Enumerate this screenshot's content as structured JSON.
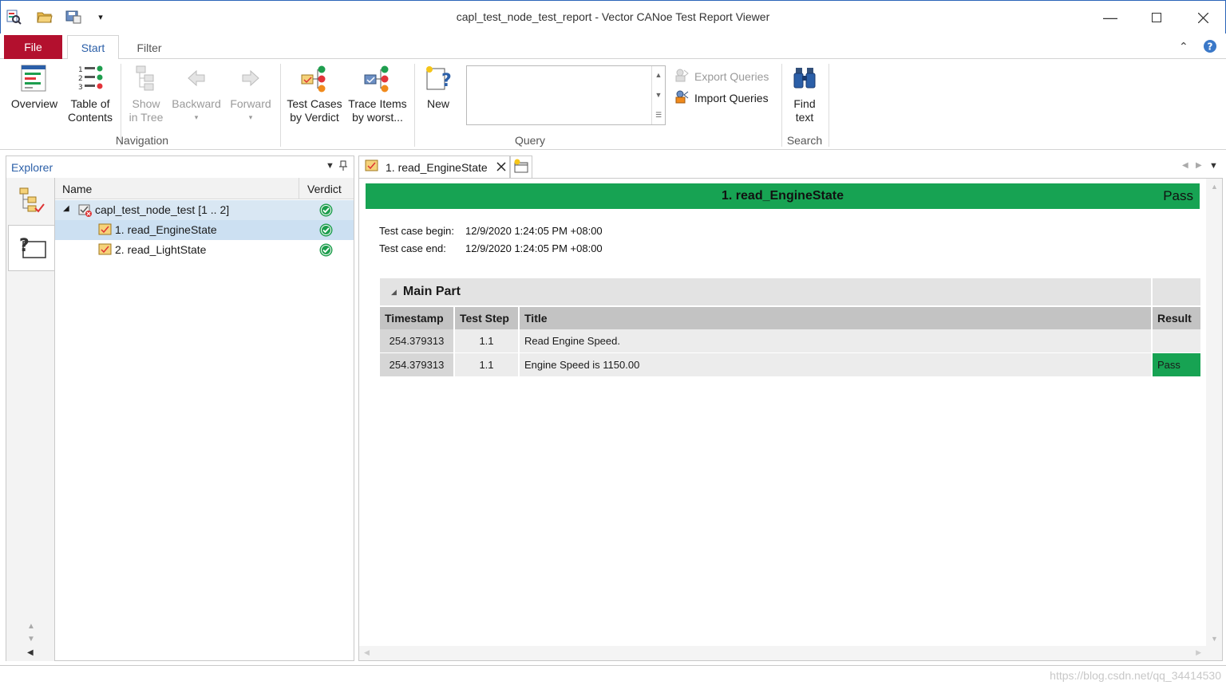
{
  "window": {
    "title": "capl_test_node_test_report - Vector CANoe Test Report Viewer"
  },
  "ribbon_tabs": {
    "file": "File",
    "start": "Start",
    "filter": "Filter"
  },
  "ribbon": {
    "overview": "Overview",
    "toc_line1": "Table of",
    "toc_line2": "Contents",
    "show_line1": "Show",
    "show_line2": "in Tree",
    "backward": "Backward",
    "forward": "Forward",
    "navigation_group": "Navigation",
    "tc_line1": "Test Cases",
    "tc_line2": "by Verdict",
    "ti_line1": "Trace Items",
    "ti_line2": "by worst...",
    "new": "New",
    "query_group": "Query",
    "export_queries": "Export Queries",
    "import_queries": "Import Queries",
    "find_line1": "Find",
    "find_line2": "text",
    "search_group": "Search"
  },
  "explorer": {
    "title": "Explorer",
    "columns": {
      "name": "Name",
      "verdict": "Verdict"
    },
    "items": [
      {
        "label": "capl_test_node_test [1 .. 2]"
      },
      {
        "label": "1. read_EngineState"
      },
      {
        "label": "2. read_LightState"
      }
    ]
  },
  "document": {
    "tab_label": "1. read_EngineState",
    "banner_title": "1. read_EngineState",
    "banner_verdict": "Pass",
    "begin_label": "Test case begin:",
    "begin_value": "12/9/2020 1:24:05 PM +08:00",
    "end_label": "Test case end:",
    "end_value": "12/9/2020 1:24:05 PM +08:00",
    "section_title": "Main Part",
    "columns": {
      "timestamp": "Timestamp",
      "step": "Test Step",
      "title": "Title",
      "result": "Result"
    },
    "rows": [
      {
        "timestamp": "254.379313",
        "step": "1.1",
        "title": "Read Engine Speed.",
        "result": ""
      },
      {
        "timestamp": "254.379313",
        "step": "1.1",
        "title": "Engine Speed is 1150.00",
        "result": "Pass"
      }
    ]
  },
  "status": {
    "watermark": "https://blog.csdn.net/qq_34414530"
  },
  "colors": {
    "file_tab": "#b3102e",
    "pass": "#17a353",
    "accent": "#2b5fa8"
  }
}
